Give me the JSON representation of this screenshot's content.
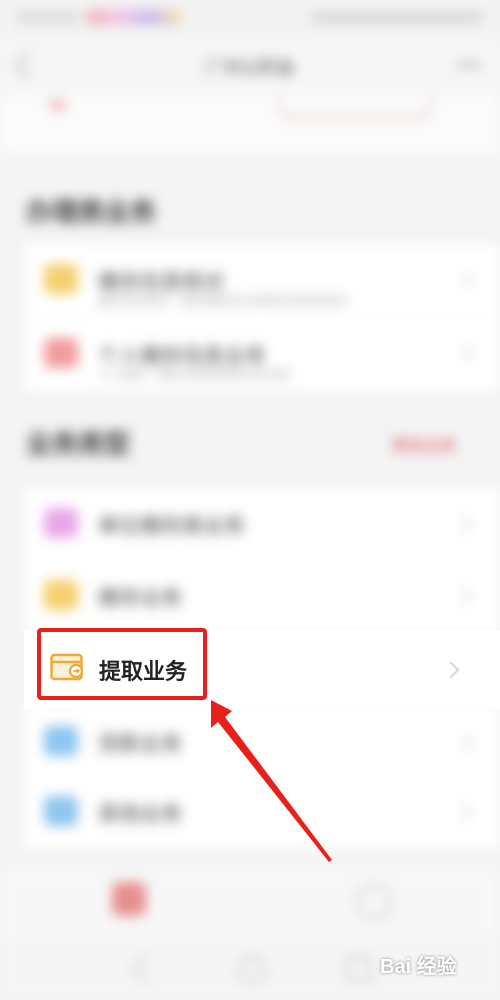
{
  "header": {
    "title": "广州公积金"
  },
  "sections": {
    "first": {
      "title": "办理类业务",
      "items": [
        {
          "label": "缴存信息核对",
          "sub": "缴存信息核对 · 缴存基数及比例等信息查询核对",
          "icon": "folder-icon",
          "icon_color": "#f6cf6d"
        },
        {
          "label": "个人缴存信息业务",
          "sub": "个人缴存 · 缴存记录变更等业务办理",
          "icon": "house-icon",
          "icon_color": "#f29b9b"
        }
      ]
    },
    "second": {
      "title": "业务类型",
      "more": "更多业务",
      "items": [
        {
          "label": "单位缴存类业务",
          "icon": "document-icon",
          "icon_color": "#e8a7e8"
        },
        {
          "label": "缴存业务",
          "icon": "wallet-icon",
          "icon_color": "#f6cf6d"
        },
        {
          "label": "提取业务",
          "icon": "wallet-withdraw-icon",
          "icon_color": "#f0a838",
          "highlighted": true
        },
        {
          "label": "贷款业务",
          "icon": "loan-icon",
          "icon_color": "#8ec5f0"
        },
        {
          "label": "其他业务",
          "icon": "globe-icon",
          "icon_color": "#8ec5f0"
        }
      ]
    }
  },
  "annotation": {
    "box_color": "#e8201c",
    "arrow_color": "#e8201c"
  },
  "watermark": {
    "text": "Bai 经验"
  },
  "colors": {
    "accent": "#d94848",
    "background": "#f4f4f4"
  }
}
